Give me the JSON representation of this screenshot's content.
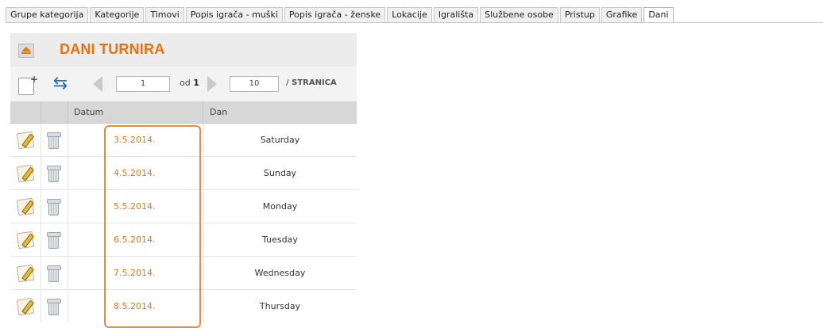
{
  "tabs": [
    {
      "label": "Grupe kategorija",
      "active": false
    },
    {
      "label": "Kategorije",
      "active": false
    },
    {
      "label": "Timovi",
      "active": false
    },
    {
      "label": "Popis igrača - muški",
      "active": false
    },
    {
      "label": "Popis igrača - ženske",
      "active": false
    },
    {
      "label": "Lokacije",
      "active": false
    },
    {
      "label": "Igrališta",
      "active": false
    },
    {
      "label": "Službene osobe",
      "active": false
    },
    {
      "label": "Pristup",
      "active": false
    },
    {
      "label": "Grafike",
      "active": false
    },
    {
      "label": "Dani",
      "active": true
    }
  ],
  "panel": {
    "title": "DANI TURNIRA"
  },
  "pager": {
    "page": "1",
    "od_label": "od",
    "total_pages": "1",
    "page_size": "10",
    "stranica_label": "/ STRANICA"
  },
  "grid": {
    "columns": [
      "",
      "",
      "Datum",
      "Dan"
    ],
    "rows": [
      {
        "datum": "3.5.2014.",
        "dan": "Saturday"
      },
      {
        "datum": "4.5.2014.",
        "dan": "Sunday"
      },
      {
        "datum": "5.5.2014.",
        "dan": "Monday"
      },
      {
        "datum": "6.5.2014.",
        "dan": "Tuesday"
      },
      {
        "datum": "7.5.2014.",
        "dan": "Wednesday"
      },
      {
        "datum": "8.5.2014.",
        "dan": "Thursday"
      }
    ]
  },
  "icons": {
    "collapse": "collapse-up-icon",
    "add": "add-record-icon",
    "refresh": "refresh-icon",
    "prev": "prev-page-icon",
    "next": "next-page-icon",
    "edit": "edit-pencil-icon",
    "delete": "trash-icon"
  },
  "colors": {
    "accent": "#e8720c",
    "date_text": "#e2781e",
    "highlight": "#f0883a"
  }
}
